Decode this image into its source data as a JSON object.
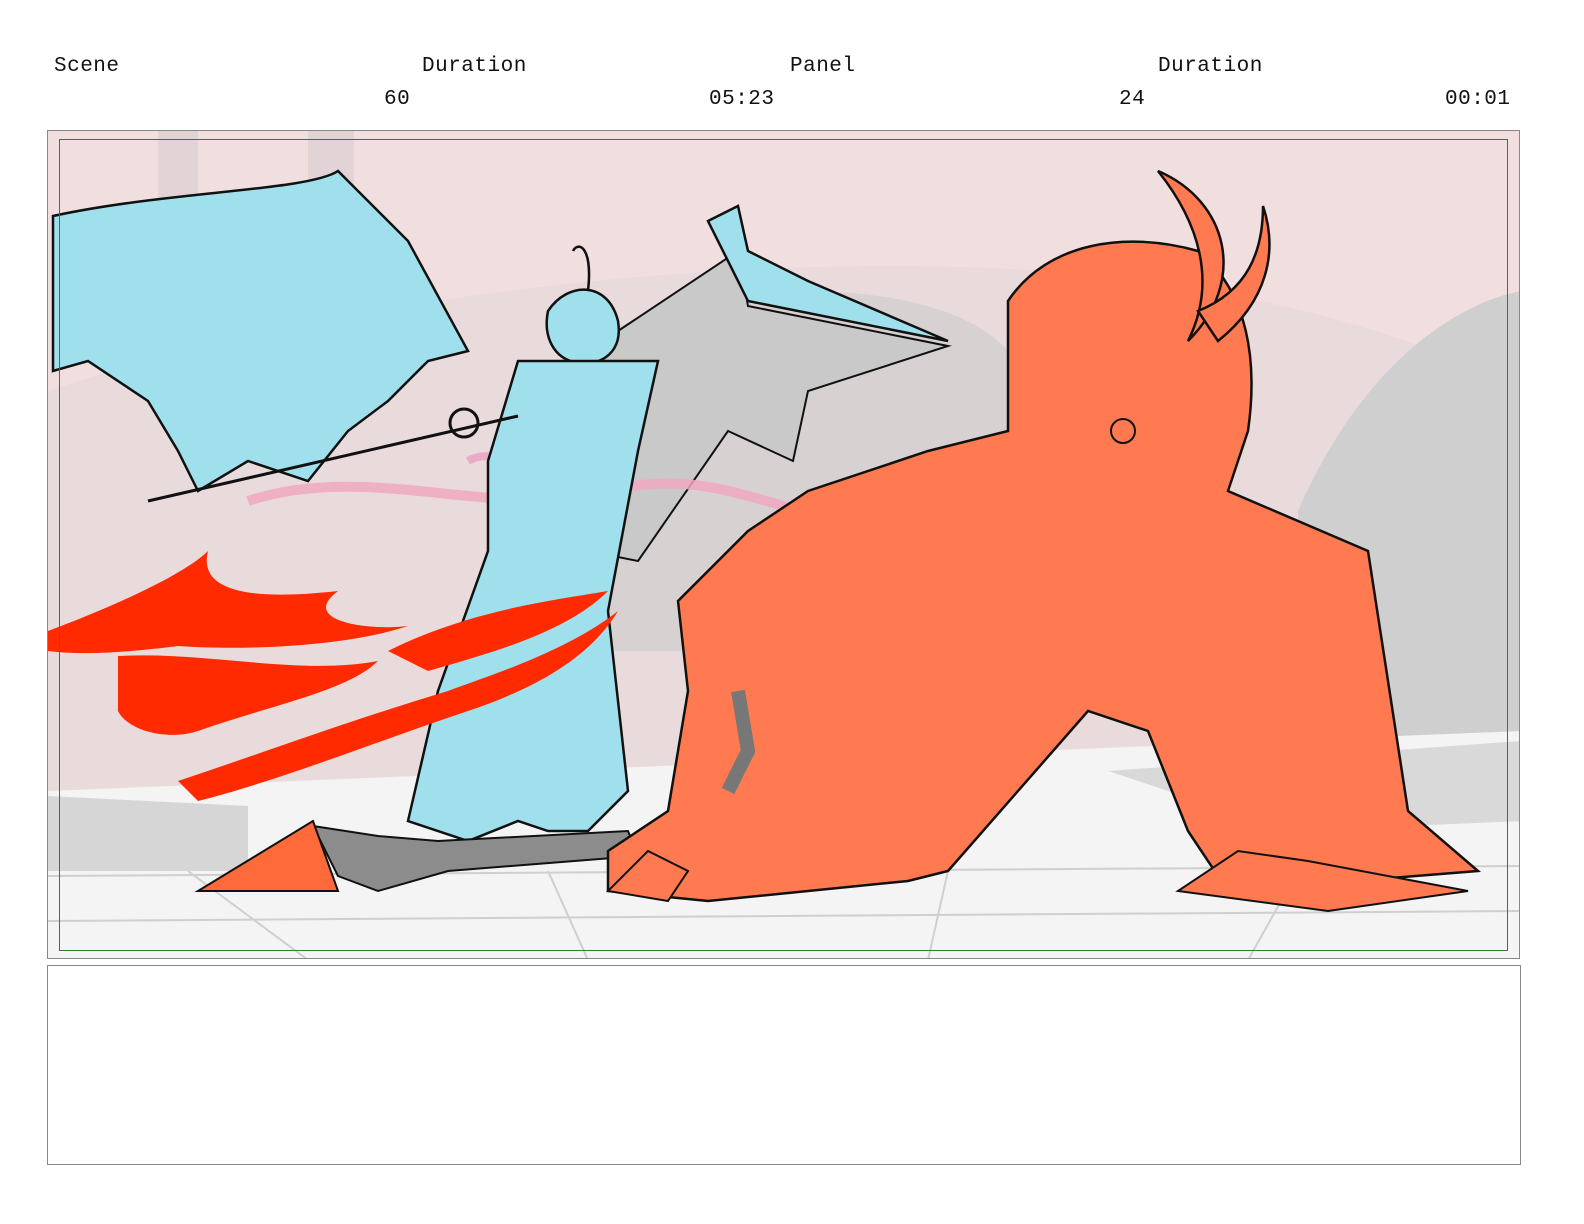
{
  "header": {
    "scene_label": "Scene",
    "duration_label": "Duration",
    "panel_label": "Panel",
    "panel_duration_label": "Duration",
    "scene_value": "60",
    "scene_duration_value": "05:23",
    "panel_value": "24",
    "panel_duration_value": "00:01"
  },
  "panel_art": {
    "left_figure": "winged-demon-with-sword",
    "right_figure": "horned-demon-crouching",
    "colors": {
      "background": "#f1dfe0",
      "sky_haze": "#e6d3d6",
      "left_figure": "#9fe0ec",
      "right_figure": "#ff7a50",
      "fire": "#ff2a00",
      "floor": "#f4f4f4",
      "grey_shapes": "#c8c8c8",
      "safe_frame": "#2f7d2f"
    }
  },
  "notes": {
    "text": ""
  }
}
